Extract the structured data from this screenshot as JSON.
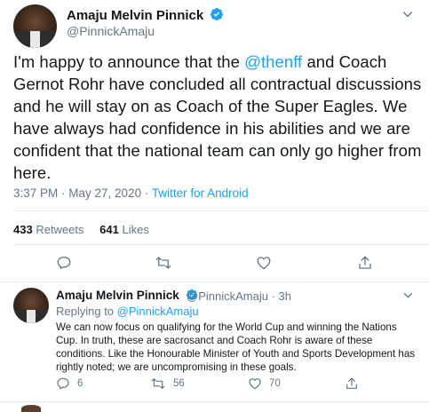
{
  "main_tweet": {
    "author_name": "Amaju Melvin Pinnick",
    "handle": "@PinnickAmaju",
    "text_before": "I'm happy to announce that the ",
    "mention": "@thenff",
    "text_after": " and Coach Gernot Rohr have concluded all contractual discussions and he will stay on as Coach of the Super Eagles. We have always had confidence in his abilities and we are confident that the national team can only go higher from here.",
    "timestamp": "3:37 PM · May 27, 2020 · ",
    "source": "Twitter for Android",
    "retweets_count": "433",
    "retweets_label": "Retweets",
    "likes_count": "641",
    "likes_label": "Likes"
  },
  "reply_tweet": {
    "author_name": "Amaju Melvin Pinnick",
    "handle_time": "@PinnickAmaju · 3h",
    "replying_prefix": "Replying to ",
    "replying_to": "@PinnickAmaju",
    "text": "We can now focus on qualifying for the World Cup and winning the Nations Cup. In truth, these are sacrosanct and Coach Rohr is aware of these conditions. Like the Honourable Minister of Youth and Sports Development has rightly noted; we are uncompromising in these goals.",
    "reply_count": "6",
    "retweet_count": "56",
    "like_count": "70"
  },
  "colors": {
    "accent": "#1da1f2",
    "muted": "#657786",
    "text": "#14171a",
    "divider": "#e6ecf0"
  },
  "icons": [
    "verified-badge-icon",
    "chevron-down-icon",
    "reply-icon",
    "retweet-icon",
    "like-icon",
    "share-icon"
  ]
}
